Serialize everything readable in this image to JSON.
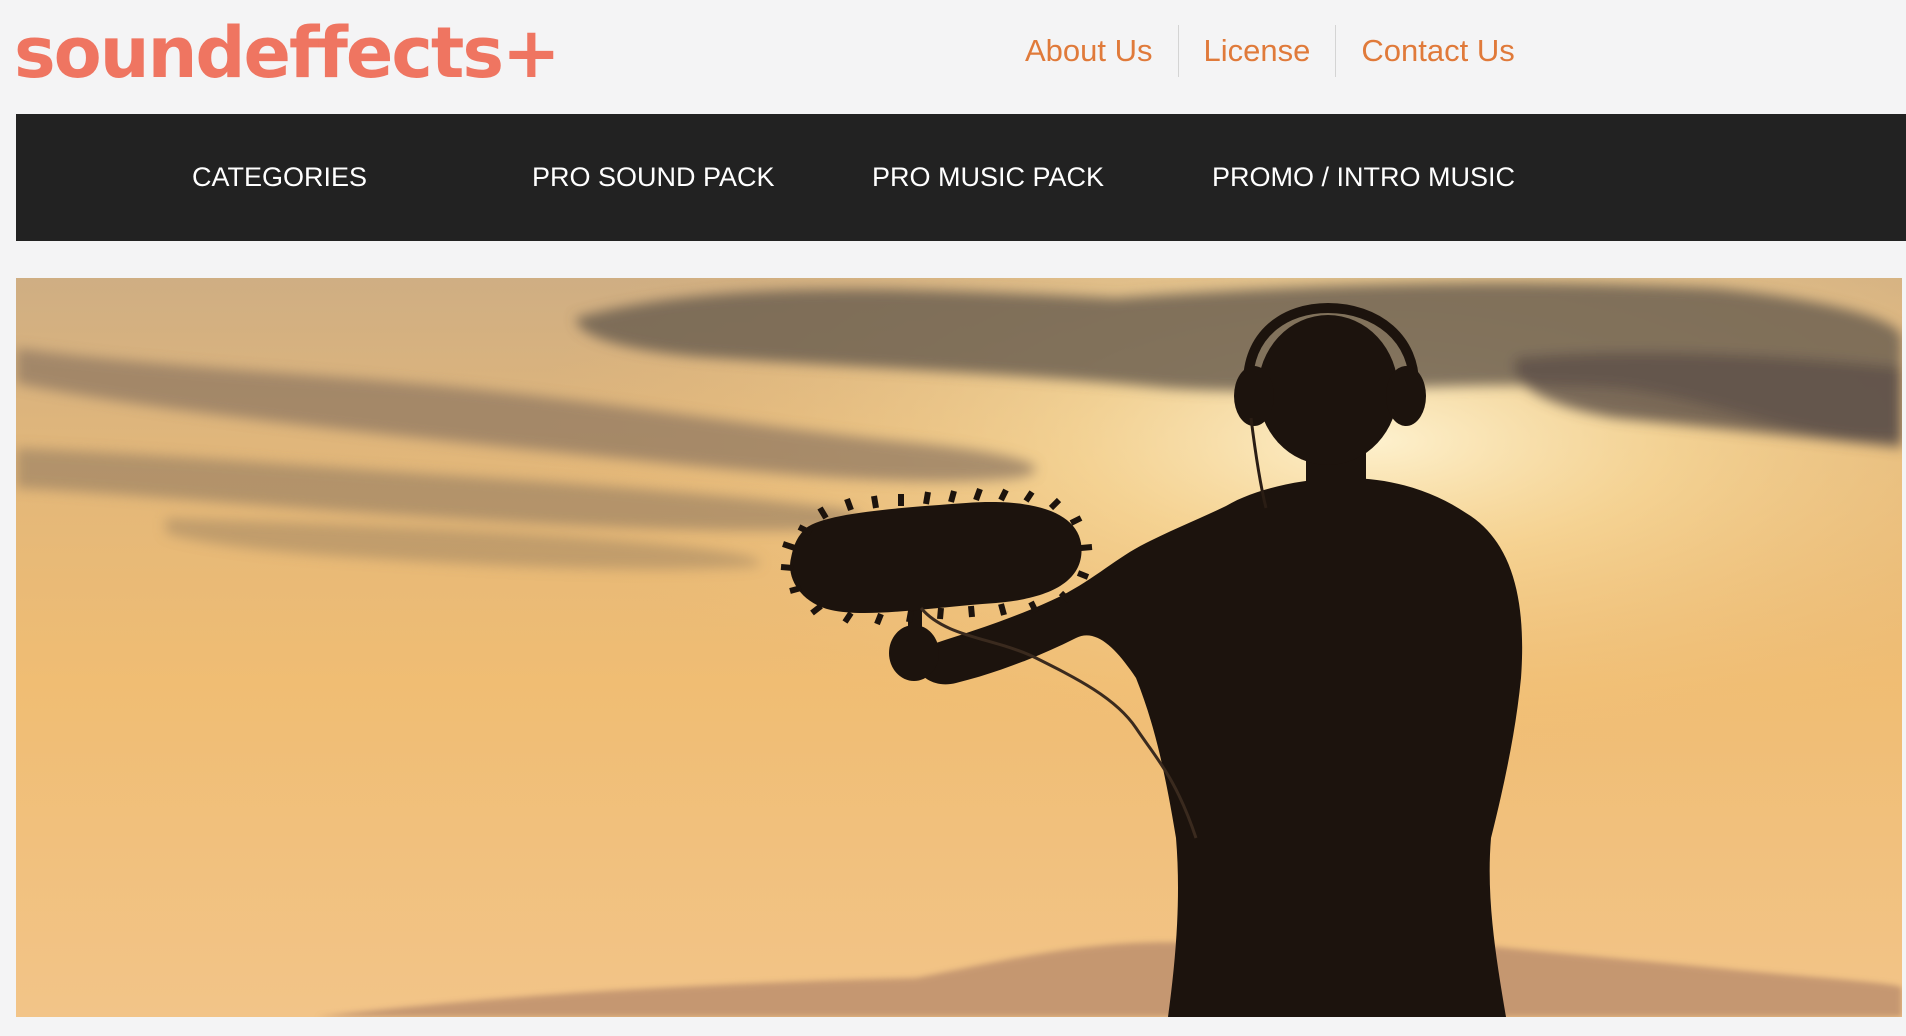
{
  "header": {
    "logo_text": "soundeffects+",
    "links": [
      {
        "label": "About Us"
      },
      {
        "label": "License"
      },
      {
        "label": "Contact Us"
      }
    ]
  },
  "nav": {
    "items": [
      {
        "label": "CATEGORIES"
      },
      {
        "label": "PRO SOUND PACK"
      },
      {
        "label": "PRO MUSIC PACK"
      },
      {
        "label": "PROMO / INTRO MUSIC"
      }
    ]
  },
  "colors": {
    "logo": "#ef7561",
    "top_link": "#e07a3a",
    "nav_background": "#222222",
    "nav_text": "#ffffff",
    "page_background": "#f4f4f5"
  }
}
